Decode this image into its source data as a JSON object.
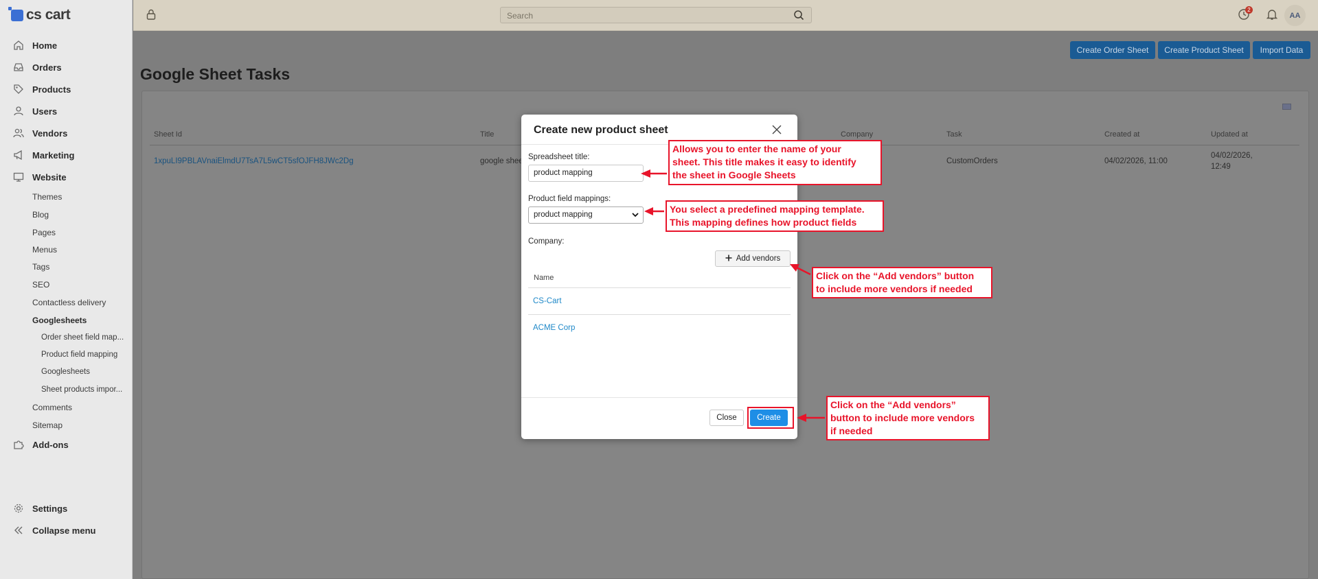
{
  "app": {
    "logo_text": "cs cart"
  },
  "sidebar": {
    "items": [
      {
        "label": "Home",
        "icon": "home-icon"
      },
      {
        "label": "Orders",
        "icon": "inbox-icon"
      },
      {
        "label": "Products",
        "icon": "tag-icon"
      },
      {
        "label": "Users",
        "icon": "user-icon"
      },
      {
        "label": "Vendors",
        "icon": "users-icon"
      },
      {
        "label": "Marketing",
        "icon": "megaphone-icon"
      },
      {
        "label": "Website",
        "icon": "monitor-icon"
      },
      {
        "label": "Add-ons",
        "icon": "puzzle-icon"
      },
      {
        "label": "Settings",
        "icon": "gear-icon"
      },
      {
        "label": "Collapse menu",
        "icon": "double-chevron-left-icon"
      }
    ],
    "website_sub": [
      "Themes",
      "Blog",
      "Pages",
      "Menus",
      "Tags",
      "SEO",
      "Contactless delivery",
      "Googlesheets",
      "Comments",
      "Sitemap"
    ],
    "googlesheets_sub": [
      "Order sheet field map...",
      "Product field mapping",
      "Googlesheets",
      "Sheet products impor..."
    ]
  },
  "topbar": {
    "search_placeholder": "Search",
    "notification_count": "2",
    "avatar_initials": "AA"
  },
  "toolbar": {
    "create_order_sheet": "Create Order Sheet",
    "create_product_sheet": "Create Product Sheet",
    "import_data": "Import Data"
  },
  "page": {
    "title": "Google Sheet Tasks"
  },
  "table": {
    "columns": [
      "Sheet Id",
      "Title",
      "Company",
      "Task",
      "Created at",
      "Updated at"
    ],
    "rows": [
      {
        "sheet_id": "1xpuLI9PBLAVnaiElmdU7TsA7L5wCT5sfOJFH8JWc2Dg",
        "title": "google shee",
        "company": "",
        "task": "CustomOrders",
        "created_at": "04/02/2026, 11:00",
        "updated_at_line1": "04/02/2026,",
        "updated_at_line2": "12:49"
      }
    ]
  },
  "modal": {
    "title": "Create new product sheet",
    "spreadsheet_title_label": "Spreadsheet title:",
    "spreadsheet_title_value": "product mapping",
    "mapping_label": "Product field mappings:",
    "mapping_value": "product mapping",
    "company_label": "Company:",
    "add_vendors": "Add vendors",
    "vendors_column": "Name",
    "vendors": [
      "CS-Cart",
      "ACME Corp"
    ],
    "close": "Close",
    "create": "Create"
  },
  "annotations": {
    "title_note": [
      "Allows you to enter the name of your",
      "sheet. This title makes it easy to identify",
      "the sheet in Google Sheets"
    ],
    "mapping_note": [
      "You select a predefined mapping template.",
      "This mapping defines how product fields"
    ],
    "vendors_note": [
      "Click on the “Add vendors” button",
      "to include more vendors if needed"
    ],
    "create_note": [
      "Click on the “Add vendors”",
      "button to include more vendors",
      "if needed"
    ],
    "color": "#e8142a"
  }
}
